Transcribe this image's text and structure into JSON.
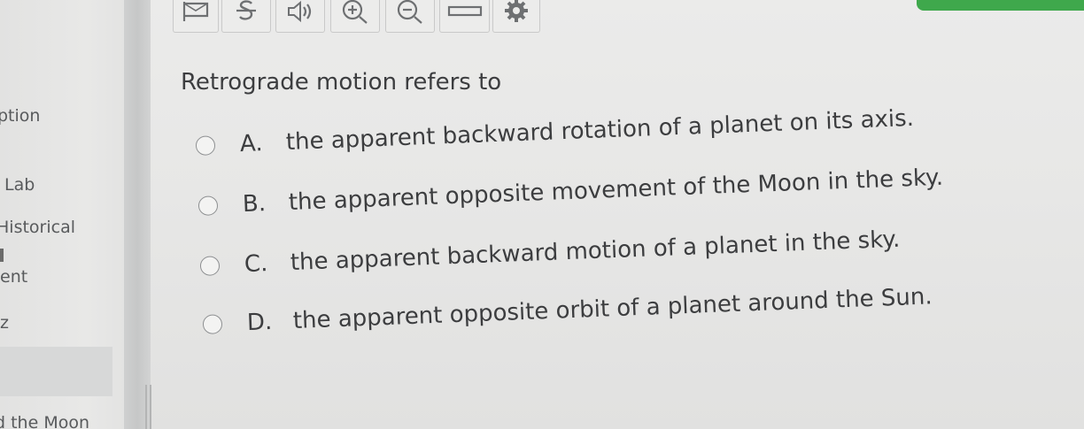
{
  "sidebar": {
    "items": [
      "ption",
      "Lab",
      "Historical",
      "ent",
      "z",
      "d the Moon"
    ]
  },
  "toolbar": {
    "buttons": [
      "flag-icon",
      "strikethrough-icon",
      "speaker-icon",
      "zoom-in-icon",
      "zoom-out-icon",
      "line-reader-icon",
      "gear-icon"
    ]
  },
  "question": {
    "text": "Retrograde motion refers to",
    "options": [
      {
        "letter": "A.",
        "text": "the apparent backward rotation of a planet on its axis."
      },
      {
        "letter": "B.",
        "text": "the apparent opposite movement of the Moon in the sky."
      },
      {
        "letter": "C.",
        "text": "the apparent backward motion of a planet in the sky."
      },
      {
        "letter": "D.",
        "text": "the apparent opposite orbit of a planet around the Sun."
      }
    ]
  },
  "colors": {
    "accent_green": "#3fa84c",
    "text": "#3c3d3f"
  }
}
